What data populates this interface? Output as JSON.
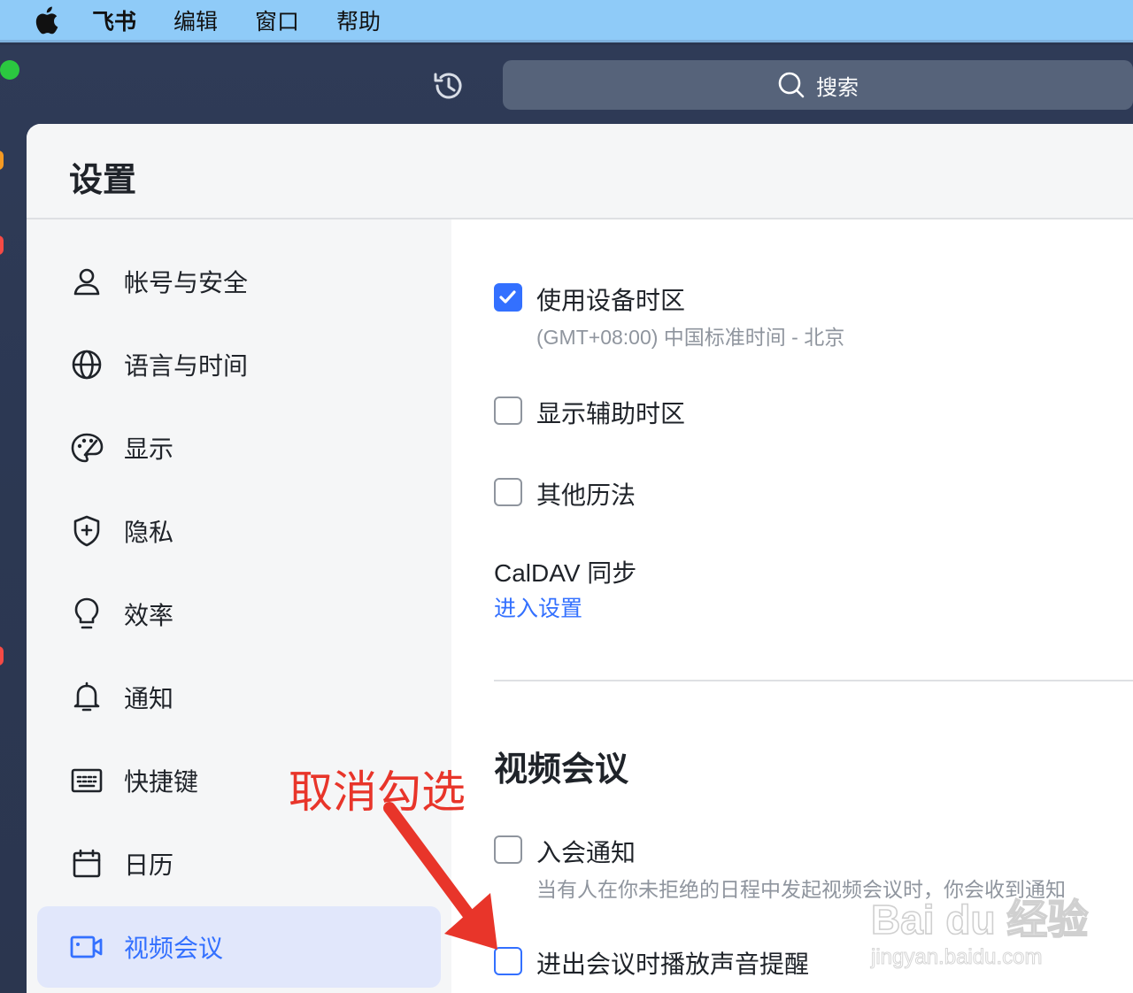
{
  "menubar": {
    "app_name": "飞书",
    "items": [
      "编辑",
      "窗口",
      "帮助"
    ]
  },
  "search": {
    "label": "搜索"
  },
  "settings": {
    "title": "设置",
    "nav": [
      {
        "label": "帐号与安全",
        "icon": "user-icon"
      },
      {
        "label": "语言与时间",
        "icon": "globe-icon"
      },
      {
        "label": "显示",
        "icon": "palette-icon"
      },
      {
        "label": "隐私",
        "icon": "shield-icon"
      },
      {
        "label": "效率",
        "icon": "bulb-icon"
      },
      {
        "label": "通知",
        "icon": "bell-icon"
      },
      {
        "label": "快捷键",
        "icon": "keyboard-icon"
      },
      {
        "label": "日历",
        "icon": "calendar-icon"
      },
      {
        "label": "视频会议",
        "icon": "video-icon",
        "active": true
      }
    ],
    "options": {
      "device_timezone": {
        "label": "使用设备时区",
        "desc": "(GMT+08:00) 中国标准时间 - 北京",
        "checked": true
      },
      "secondary_timezone": {
        "label": "显示辅助时区",
        "checked": false
      },
      "other_calendars": {
        "label": "其他历法",
        "checked": false
      }
    },
    "caldav": {
      "label": "CalDAV 同步",
      "link": "进入设置"
    },
    "video_section": {
      "title": "视频会议",
      "join_notice": {
        "label": "入会通知",
        "desc": "当有人在你未拒绝的日程中发起视频会议时，你会收到通知",
        "checked": false
      },
      "sound_reminder": {
        "label": "进出会议时播放声音提醒",
        "checked": false
      }
    }
  },
  "annotation": {
    "text": "取消勾选"
  },
  "watermark": {
    "brand": "Bai du 经验",
    "url": "jingyan.baidu.com"
  },
  "colors": {
    "accent": "#3370ff",
    "annotation": "#e8352a",
    "menubar": "#8fcbf8"
  }
}
